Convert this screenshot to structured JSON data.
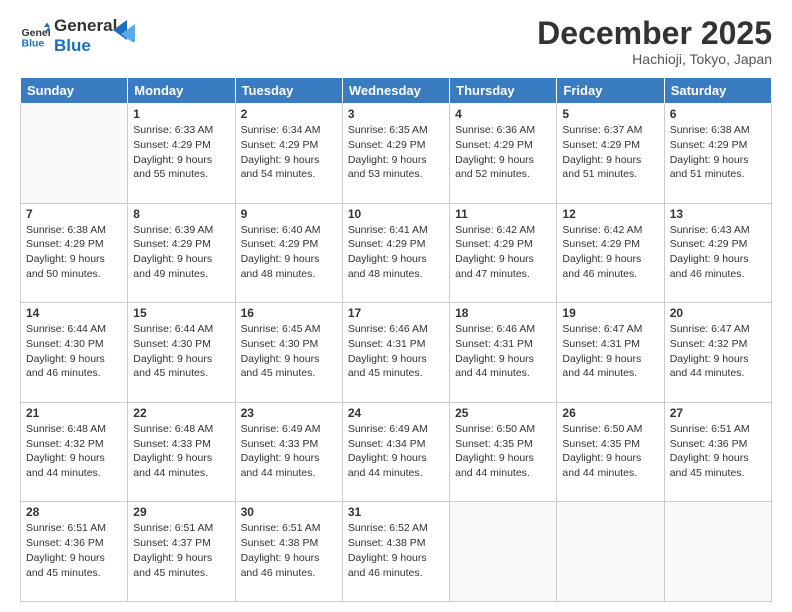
{
  "logo": {
    "line1": "General",
    "line2": "Blue"
  },
  "header": {
    "month": "December 2025",
    "location": "Hachioji, Tokyo, Japan"
  },
  "weekdays": [
    "Sunday",
    "Monday",
    "Tuesday",
    "Wednesday",
    "Thursday",
    "Friday",
    "Saturday"
  ],
  "weeks": [
    [
      {
        "day": "",
        "info": ""
      },
      {
        "day": "1",
        "info": "Sunrise: 6:33 AM\nSunset: 4:29 PM\nDaylight: 9 hours\nand 55 minutes."
      },
      {
        "day": "2",
        "info": "Sunrise: 6:34 AM\nSunset: 4:29 PM\nDaylight: 9 hours\nand 54 minutes."
      },
      {
        "day": "3",
        "info": "Sunrise: 6:35 AM\nSunset: 4:29 PM\nDaylight: 9 hours\nand 53 minutes."
      },
      {
        "day": "4",
        "info": "Sunrise: 6:36 AM\nSunset: 4:29 PM\nDaylight: 9 hours\nand 52 minutes."
      },
      {
        "day": "5",
        "info": "Sunrise: 6:37 AM\nSunset: 4:29 PM\nDaylight: 9 hours\nand 51 minutes."
      },
      {
        "day": "6",
        "info": "Sunrise: 6:38 AM\nSunset: 4:29 PM\nDaylight: 9 hours\nand 51 minutes."
      }
    ],
    [
      {
        "day": "7",
        "info": "Sunrise: 6:38 AM\nSunset: 4:29 PM\nDaylight: 9 hours\nand 50 minutes."
      },
      {
        "day": "8",
        "info": "Sunrise: 6:39 AM\nSunset: 4:29 PM\nDaylight: 9 hours\nand 49 minutes."
      },
      {
        "day": "9",
        "info": "Sunrise: 6:40 AM\nSunset: 4:29 PM\nDaylight: 9 hours\nand 48 minutes."
      },
      {
        "day": "10",
        "info": "Sunrise: 6:41 AM\nSunset: 4:29 PM\nDaylight: 9 hours\nand 48 minutes."
      },
      {
        "day": "11",
        "info": "Sunrise: 6:42 AM\nSunset: 4:29 PM\nDaylight: 9 hours\nand 47 minutes."
      },
      {
        "day": "12",
        "info": "Sunrise: 6:42 AM\nSunset: 4:29 PM\nDaylight: 9 hours\nand 46 minutes."
      },
      {
        "day": "13",
        "info": "Sunrise: 6:43 AM\nSunset: 4:29 PM\nDaylight: 9 hours\nand 46 minutes."
      }
    ],
    [
      {
        "day": "14",
        "info": "Sunrise: 6:44 AM\nSunset: 4:30 PM\nDaylight: 9 hours\nand 46 minutes."
      },
      {
        "day": "15",
        "info": "Sunrise: 6:44 AM\nSunset: 4:30 PM\nDaylight: 9 hours\nand 45 minutes."
      },
      {
        "day": "16",
        "info": "Sunrise: 6:45 AM\nSunset: 4:30 PM\nDaylight: 9 hours\nand 45 minutes."
      },
      {
        "day": "17",
        "info": "Sunrise: 6:46 AM\nSunset: 4:31 PM\nDaylight: 9 hours\nand 45 minutes."
      },
      {
        "day": "18",
        "info": "Sunrise: 6:46 AM\nSunset: 4:31 PM\nDaylight: 9 hours\nand 44 minutes."
      },
      {
        "day": "19",
        "info": "Sunrise: 6:47 AM\nSunset: 4:31 PM\nDaylight: 9 hours\nand 44 minutes."
      },
      {
        "day": "20",
        "info": "Sunrise: 6:47 AM\nSunset: 4:32 PM\nDaylight: 9 hours\nand 44 minutes."
      }
    ],
    [
      {
        "day": "21",
        "info": "Sunrise: 6:48 AM\nSunset: 4:32 PM\nDaylight: 9 hours\nand 44 minutes."
      },
      {
        "day": "22",
        "info": "Sunrise: 6:48 AM\nSunset: 4:33 PM\nDaylight: 9 hours\nand 44 minutes."
      },
      {
        "day": "23",
        "info": "Sunrise: 6:49 AM\nSunset: 4:33 PM\nDaylight: 9 hours\nand 44 minutes."
      },
      {
        "day": "24",
        "info": "Sunrise: 6:49 AM\nSunset: 4:34 PM\nDaylight: 9 hours\nand 44 minutes."
      },
      {
        "day": "25",
        "info": "Sunrise: 6:50 AM\nSunset: 4:35 PM\nDaylight: 9 hours\nand 44 minutes."
      },
      {
        "day": "26",
        "info": "Sunrise: 6:50 AM\nSunset: 4:35 PM\nDaylight: 9 hours\nand 44 minutes."
      },
      {
        "day": "27",
        "info": "Sunrise: 6:51 AM\nSunset: 4:36 PM\nDaylight: 9 hours\nand 45 minutes."
      }
    ],
    [
      {
        "day": "28",
        "info": "Sunrise: 6:51 AM\nSunset: 4:36 PM\nDaylight: 9 hours\nand 45 minutes."
      },
      {
        "day": "29",
        "info": "Sunrise: 6:51 AM\nSunset: 4:37 PM\nDaylight: 9 hours\nand 45 minutes."
      },
      {
        "day": "30",
        "info": "Sunrise: 6:51 AM\nSunset: 4:38 PM\nDaylight: 9 hours\nand 46 minutes."
      },
      {
        "day": "31",
        "info": "Sunrise: 6:52 AM\nSunset: 4:38 PM\nDaylight: 9 hours\nand 46 minutes."
      },
      {
        "day": "",
        "info": ""
      },
      {
        "day": "",
        "info": ""
      },
      {
        "day": "",
        "info": ""
      }
    ]
  ]
}
